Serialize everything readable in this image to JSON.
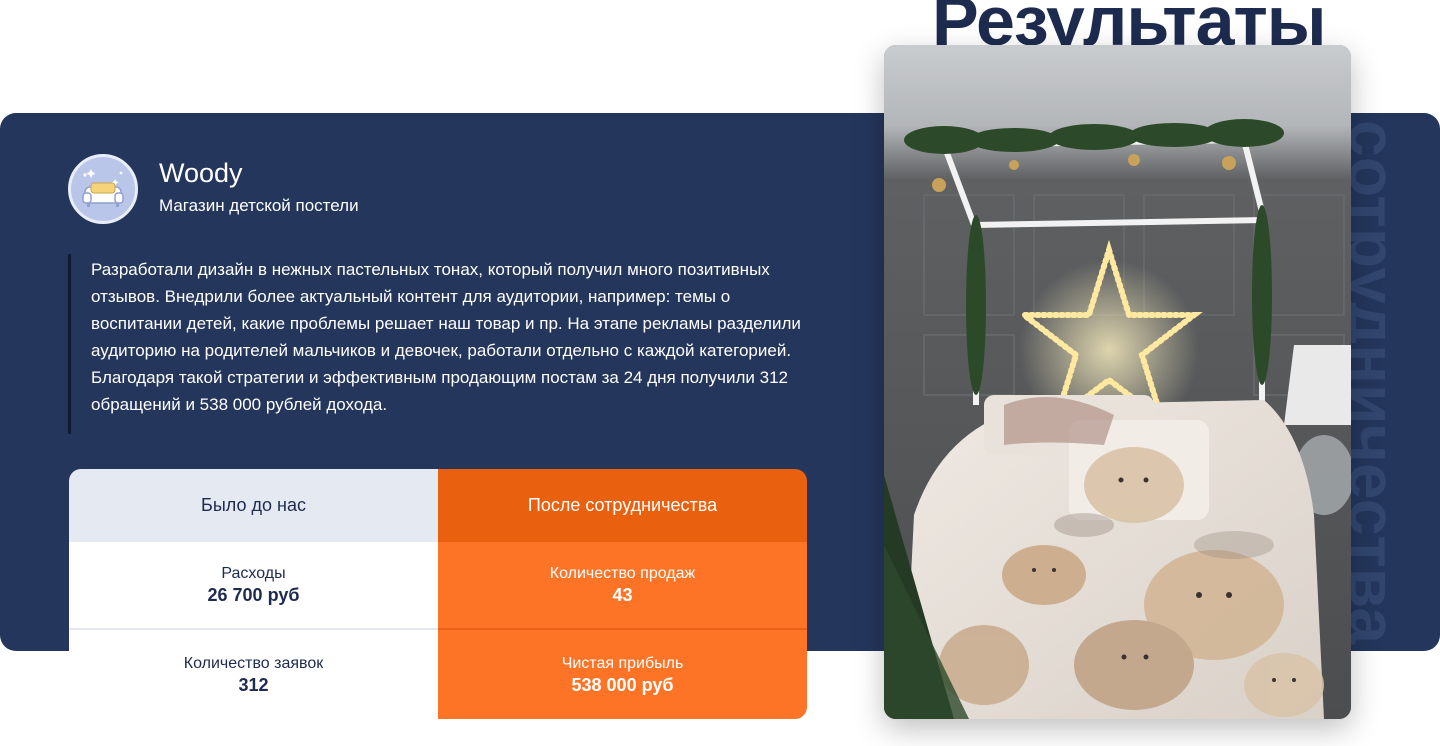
{
  "section": {
    "title": "Результаты",
    "vertical_word": "сотрудничества"
  },
  "brand": {
    "name": "Woody",
    "subtitle": "Магазин детской постели",
    "avatar_icon": "sofa-icon"
  },
  "description": "Разработали дизайн в нежных пастельных тонах, который получил много позитивных отзывов. Внедрили более актуальный контент для аудитории, например: темы о воспитании детей, какие проблемы решает наш товар и пр. На этапе рекламы разделили аудиторию на родителей мальчиков и девочек, работали отдельно с каждой категорией. Благодаря такой стратегии и эффективным продающим постам за 24 дня получили 312 обращений и 538 000 рублей дохода.",
  "stats": {
    "before_header": "Было до нас",
    "after_header": "После сотрудничества",
    "before": [
      {
        "label": "Расходы",
        "value": "26 700 руб"
      },
      {
        "label": "Количество заявок",
        "value": "312"
      }
    ],
    "after": [
      {
        "label": "Количество продаж",
        "value": "43"
      },
      {
        "label": "Чистая прибыль",
        "value": "538 000 руб"
      }
    ]
  },
  "colors": {
    "navy": "#24365c",
    "accent_orange": "#fd7426",
    "accent_orange_dark": "#e9600f",
    "light_gray": "#e4e9f2"
  }
}
